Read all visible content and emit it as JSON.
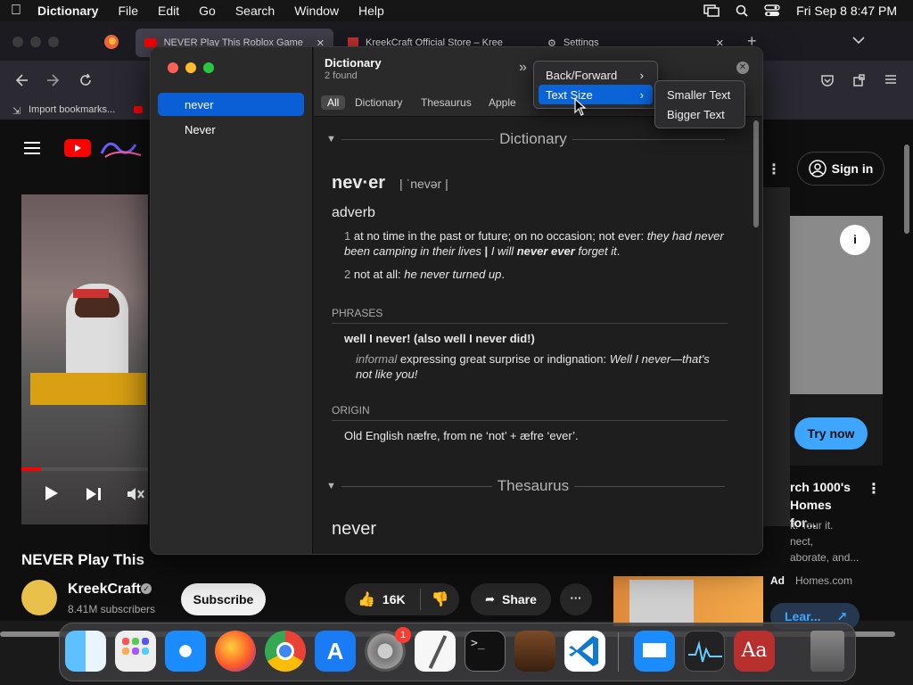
{
  "menubar": {
    "app": "Dictionary",
    "items": [
      "File",
      "Edit",
      "Go",
      "Search",
      "Window",
      "Help"
    ],
    "clock": "Fri Sep 8  8:47 PM"
  },
  "browser": {
    "tabs": [
      {
        "title": "NEVER Play This Roblox Game"
      },
      {
        "title": "KreekCraft Official Store – Kree"
      },
      {
        "title": "Settings"
      }
    ],
    "bookmarks": "Import bookmarks..."
  },
  "youtube": {
    "video_title": "NEVER Play This",
    "channel": "KreekCraft",
    "subscribers": "8.41M subscribers",
    "subscribe": "Subscribe",
    "likes": "16K",
    "share": "Share",
    "sign_in": "Sign in",
    "try_now": "Try now",
    "ad_title": "rch 1000's\nHomes for...",
    "ad_desc": "it. Tour it.\nnect,\naborate, and...",
    "ad_label": "Ad",
    "ad_source": "Homes.com",
    "learn": "Lear..."
  },
  "dictionary": {
    "sidebar": [
      {
        "label": "never",
        "selected": true
      },
      {
        "label": "Never",
        "selected": false
      }
    ],
    "title": "Dictionary",
    "found": "2 found",
    "filters": [
      "All",
      "Dictionary",
      "Thesaurus",
      "Apple"
    ],
    "section1": "Dictionary",
    "headword": "nev·er",
    "pron": "| ˈnevər |",
    "pos": "adverb",
    "sense1_num": "1",
    "sense1_def": "at no time in the past or future; on no occasion; not ever:",
    "sense1_ex_a": "they had never been camping in their lives",
    "sense1_sep": "|",
    "sense1_ex_b": "I will",
    "sense1_ex_bold": "never ever",
    "sense1_ex_c": "forget it",
    "sense2_num": "2",
    "sense2_def": "not at all:",
    "sense2_ex": "he never turned up",
    "phrases_label": "PHRASES",
    "phrase": "well I never! (also well I never did!)",
    "phrase_reg": "informal",
    "phrase_def": "expressing great surprise or indignation:",
    "phrase_ex": "Well I never—that's not like you!",
    "origin_label": "ORIGIN",
    "origin": "Old English næfre, from ne ‘not’ + æfre ‘ever’.",
    "section2": "Thesaurus",
    "thes_head": "never"
  },
  "context_menu": {
    "items": [
      "Back/Forward",
      "Text Size"
    ],
    "submenu": [
      "Smaller Text",
      "Bigger Text"
    ]
  },
  "dock": {
    "badge": "1"
  }
}
